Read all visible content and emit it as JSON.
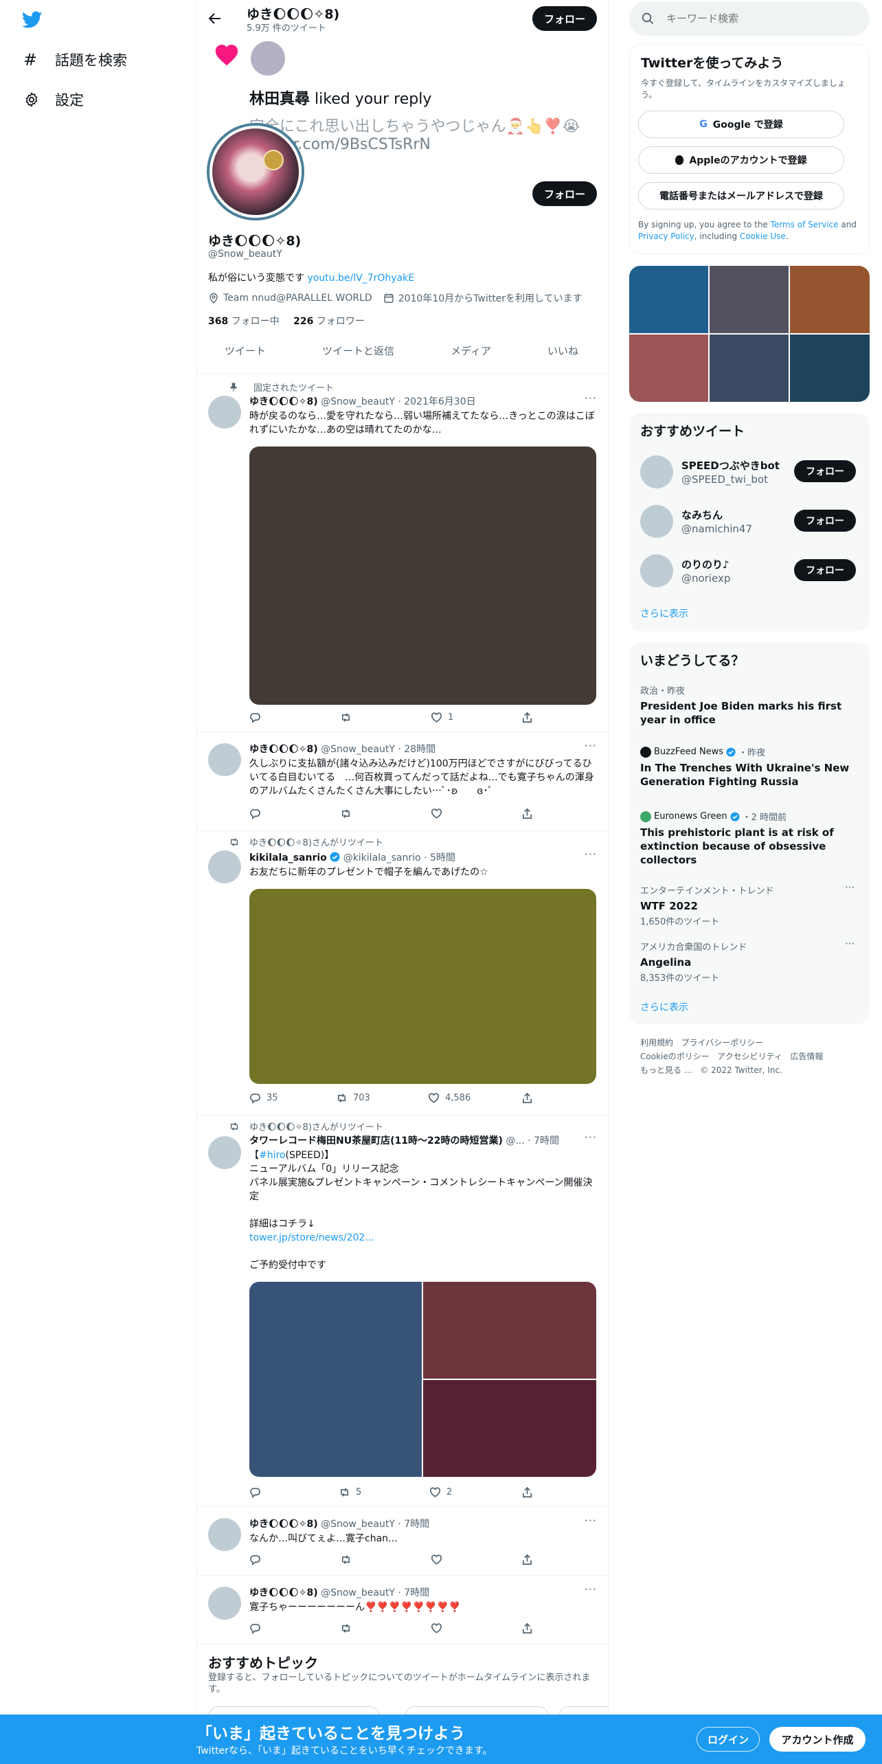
{
  "nav": {
    "explore": "話題を検索",
    "settings": "設定"
  },
  "header": {
    "name": "ゆき🌔🌔🌔✧8)",
    "tweet_count": "5.9万 件のツイート",
    "follow": "フォロー"
  },
  "overlay": {
    "liker": "林田真尋",
    "liked_text": "liked your reply",
    "reply_text": "完全にこれ思い出しちゃうやつじゃん🎅👆❣️😭",
    "reply_link": "twitter.com/9BsCSTsRrN"
  },
  "profile": {
    "follow": "フォロー",
    "name": "ゆき🌔🌔🌔✧8)",
    "handle": "@Snow_beautY",
    "bio": "私が俗にいう変態です",
    "bio_link": "youtu.be/lV_7rOhyakE",
    "location": "Team nnud@PARALLEL WORLD",
    "joined": "2010年10月からTwitterを利用しています",
    "following_count": "368",
    "following_label": "フォロー中",
    "followers_count": "226",
    "followers_label": "フォロワー"
  },
  "tabs": [
    "ツイート",
    "ツイートと返信",
    "メディア",
    "いいね"
  ],
  "tweets": [
    {
      "context": "固定されたツイート",
      "name": "ゆき🌔🌔🌔✧8)",
      "handle": "@Snow_beautY",
      "time": "2021年6月30日",
      "text": "時が戻るのなら…愛を守れたなら…弱い場所補えてたなら…きっとこの涙はこぼれずにいたかな…あの空は晴れてたのかな…",
      "media_color": "#433a33",
      "likes": "1"
    },
    {
      "name": "ゆき🌔🌔🌔✧8)",
      "handle": "@Snow_beautY",
      "time": "28時間",
      "text": "久しぶりに支払額が(諸々込み込みだけど)100万円ほどでさすがにびびってるひいてる白目むいてる　…何百枚買ってんだって話だよね…でも寛子ちゃんの渾身のアルバムたくさんたくさん大事にしたい…ﾟ･ʚ　　ɞ･ﾟ"
    },
    {
      "context": "ゆき🌔🌔🌔✧8)さんがリツイート",
      "name": "kikilala_sanrio",
      "handle": "@kikilala_sanrio",
      "time": "5時間",
      "text": "お友だちに新年のプレゼントで帽子を編んであげたの☆",
      "media_color": "#747427",
      "replies": "35",
      "retweets": "703",
      "likes": "4,586"
    },
    {
      "context": "ゆき🌔🌔🌔✧8)さんがリツイート",
      "name": "タワーレコード梅田NU茶屋町店(11時〜22時の時短営業)",
      "handle": "@...",
      "time": "7時間",
      "line1_open": "【",
      "hashtag": "#hiro",
      "line1_rest": "(SPEED)】",
      "line2": "ニューアルバム「0」リリース記念",
      "line3": "パネル展実施&プレゼントキャンペーン・コメントレシートキャンペーン開催決定",
      "line4": "詳細はコチラ↓",
      "link": "tower.jp/store/news/202...",
      "line5": "ご予約受付中です",
      "media_colors": [
        "#375478",
        "#6c363c",
        "#562232"
      ],
      "retweets": "5",
      "likes": "2"
    },
    {
      "name": "ゆき🌔🌔🌔✧8)",
      "handle": "@Snow_beautY",
      "time": "7時間",
      "text": "なんか…叫びてぇよ…寛子chan…"
    },
    {
      "name": "ゆき🌔🌔🌔✧8)",
      "handle": "@Snow_beautY",
      "time": "7時間",
      "text": "寛子ちゃーーーーーーーん❣️❣️❣️❣️❣️❣️❣️❣️"
    }
  ],
  "topics": {
    "title": "おすすめトピック",
    "desc": "登録すると、フォローしているトピックについてのツイートがホームタイムラインに表示されます。"
  },
  "search": {
    "placeholder": "キーワード検索"
  },
  "signup": {
    "title": "Twitterを使ってみよう",
    "desc": "今すぐ登録して、タイムラインをカスタマイズしましょう。",
    "google": "Google で登録",
    "apple": "Appleのアカウントで登録",
    "phone": "電話番号またはメールアドレスで登録",
    "legal_prefix": "By signing up, you agree to the",
    "terms": "Terms of Service",
    "legal_and": "and",
    "privacy": "Privacy Policy",
    "legal_including": ", including",
    "cookie": "Cookie Use",
    "legal_end": "."
  },
  "media_grid": [
    "#1f5f8e",
    "#555060",
    "#96552e",
    "#9c5557",
    "#3c4b63",
    "#1d445a"
  ],
  "who_to_follow": {
    "title": "おすすめツイート",
    "users": [
      {
        "name": "SPEEDつぶやきbot",
        "handle": "@SPEED_twi_bot",
        "button": "フォロー"
      },
      {
        "name": "なみちん",
        "handle": "@namichin47",
        "button": "フォロー"
      },
      {
        "name": "のりのり♪",
        "handle": "@noriexp",
        "button": "フォロー"
      }
    ],
    "more": "さらに表示"
  },
  "trends": {
    "title": "いまどうしてる？",
    "items": [
      {
        "meta": "政治・昨夜",
        "title": "President Joe Biden marks his first year in office"
      },
      {
        "source": "BuzzFeed News",
        "meta": "・昨夜",
        "title": "In The Trenches With Ukraine's New Generation Fighting Russia"
      },
      {
        "source": "Euronews Green",
        "meta": "・2 時間前",
        "title": "This prehistoric plant is at risk of extinction because of obsessive collectors"
      },
      {
        "meta": "エンターテインメント・トレンド",
        "title": "WTF 2022",
        "count": "1,650件のツイート"
      },
      {
        "meta": "アメリカ合衆国のトレンド",
        "title": "Angelina",
        "count": "8,353件のツイート"
      }
    ],
    "more": "さらに表示"
  },
  "footer": {
    "terms": "利用規約",
    "privacy": "プライバシーポリシー",
    "cookie": "Cookieのポリシー",
    "accessibility": "アクセシビリティ",
    "ads": "広告情報",
    "more": "もっと見る …",
    "copyright": "© 2022 Twitter, Inc."
  },
  "bottom_bar": {
    "title": "「いま」起きていることを見つけよう",
    "subtitle": "Twitterなら、「いま」起きていることをいち早くチェックできます。",
    "login": "ログイン",
    "signup": "アカウント作成"
  },
  "colors": {
    "accent": "#1d9bf0",
    "dark": "#0f1419",
    "muted": "#536471",
    "heart": "#f91880"
  }
}
